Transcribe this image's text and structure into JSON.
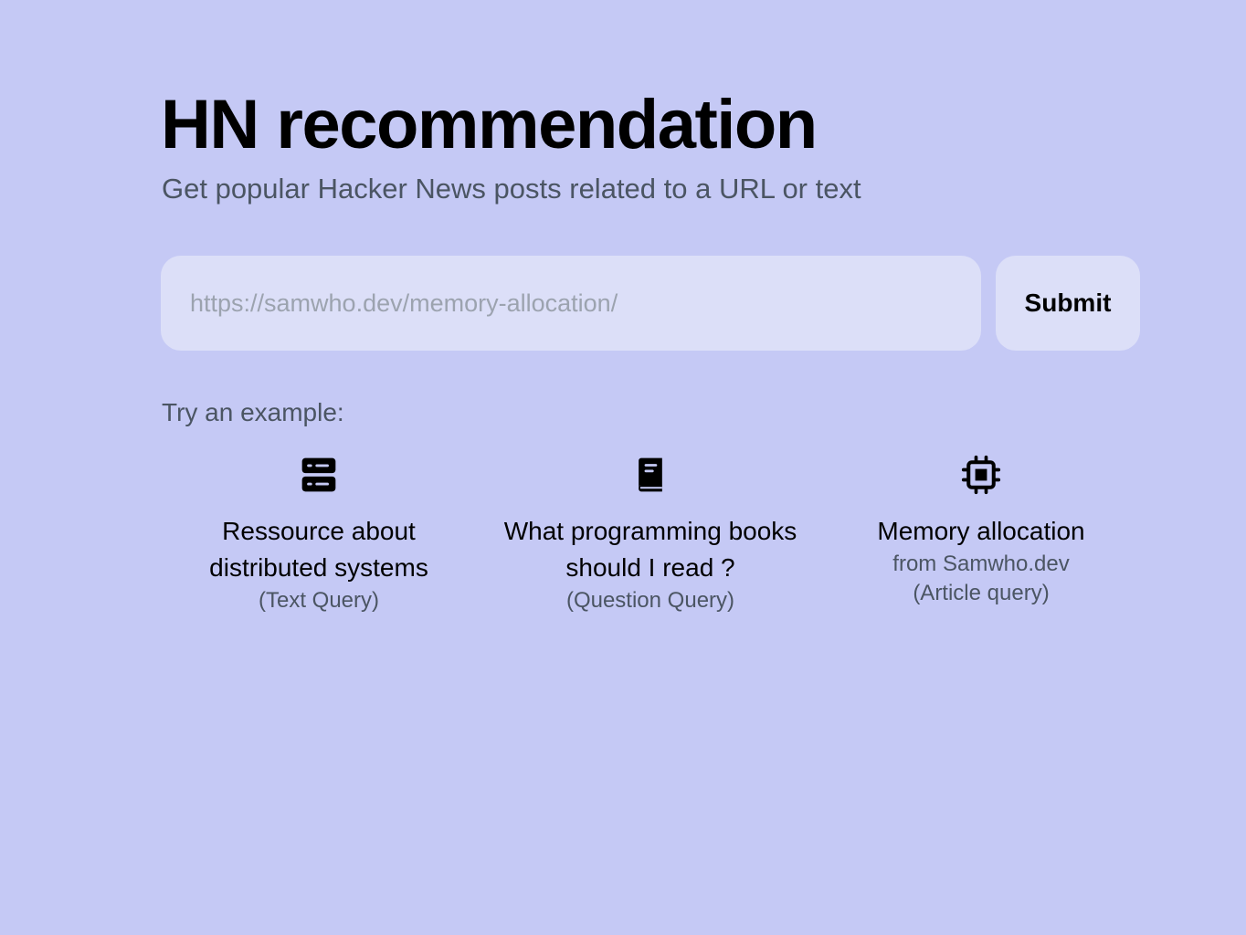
{
  "header": {
    "title": "HN recommendation",
    "subtitle": "Get popular Hacker News posts related to a URL or text"
  },
  "search": {
    "placeholder": "https://samwho.dev/memory-allocation/",
    "submit_label": "Submit"
  },
  "examples": {
    "heading": "Try an example:",
    "items": [
      {
        "icon": "server-icon",
        "line1": "Ressource about",
        "line2": "distributed systems",
        "type": "(Text Query)"
      },
      {
        "icon": "book-icon",
        "line1": "What programming books",
        "line2": "should I read ?",
        "type": "(Question Query)"
      },
      {
        "icon": "cpu-chip-icon",
        "line1": "Memory allocation",
        "source": "from Samwho.dev",
        "type": "(Article query)"
      }
    ]
  },
  "colors": {
    "background": "#c5c9f5",
    "input_background": "#dcdff8",
    "muted_text": "#4b5563"
  }
}
